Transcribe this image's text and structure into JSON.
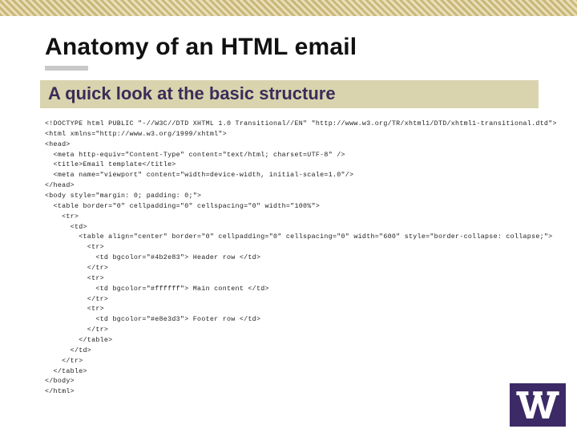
{
  "title": "Anatomy of an HTML email",
  "subtitle": "A quick look at the basic structure",
  "code_lines": [
    "<!DOCTYPE html PUBLIC \"-//W3C//DTD XHTML 1.0 Transitional//EN\" \"http://www.w3.org/TR/xhtml1/DTD/xhtml1-transitional.dtd\">",
    "<html xmlns=\"http://www.w3.org/1999/xhtml\">",
    "<head>",
    "  <meta http-equiv=\"Content-Type\" content=\"text/html; charset=UTF-8\" />",
    "  <title>Email template</title>",
    "  <meta name=\"viewport\" content=\"width=device-width, initial-scale=1.0\"/>",
    "</head>",
    "<body style=\"margin: 0; padding: 0;\">",
    "  <table border=\"0\" cellpadding=\"0\" cellspacing=\"0\" width=\"100%\">",
    "    <tr>",
    "      <td>",
    "        <table align=\"center\" border=\"0\" cellpadding=\"0\" cellspacing=\"0\" width=\"600\" style=\"border-collapse: collapse;\">",
    "          <tr>",
    "            <td bgcolor=\"#4b2e83\"> Header row </td>",
    "          </tr>",
    "          <tr>",
    "            <td bgcolor=\"#ffffff\"> Main content </td>",
    "          </tr>",
    "          <tr>",
    "            <td bgcolor=\"#e8e3d3\"> Footer row </td>",
    "          </tr>",
    "        </table>",
    "      </td>",
    "    </tr>",
    "  </table>",
    "</body>",
    "</html>"
  ],
  "logo": {
    "letter": "W",
    "bg": "#3b2a66",
    "fg": "#ffffff"
  }
}
